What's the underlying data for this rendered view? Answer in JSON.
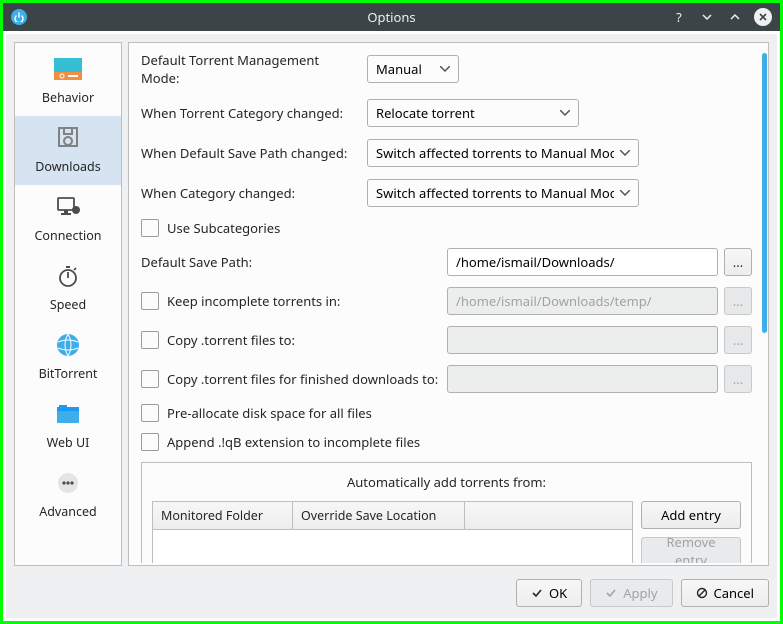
{
  "window": {
    "title": "Options"
  },
  "sidebar": {
    "items": [
      {
        "label": "Behavior"
      },
      {
        "label": "Downloads"
      },
      {
        "label": "Connection"
      },
      {
        "label": "Speed"
      },
      {
        "label": "BitTorrent"
      },
      {
        "label": "Web UI"
      },
      {
        "label": "Advanced"
      }
    ]
  },
  "form": {
    "mgmt_mode_label": "Default Torrent Management Mode:",
    "mgmt_mode_value": "Manual",
    "cat_changed_label": "When Torrent Category changed:",
    "cat_changed_value": "Relocate torrent",
    "def_path_changed_label": "When Default Save Path changed:",
    "def_path_changed_value": "Switch affected torrents to Manual Mode",
    "when_cat_changed_label": "When Category changed:",
    "when_cat_changed_value": "Switch affected torrents to Manual Mode",
    "use_subcategories": "Use Subcategories",
    "default_save_path_label": "Default Save Path:",
    "default_save_path_value": "/home/ismail/Downloads/",
    "keep_incomplete_label": "Keep incomplete torrents in:",
    "keep_incomplete_placeholder": "/home/ismail/Downloads/temp/",
    "copy_torrent_label": "Copy .torrent files to:",
    "copy_finished_label": "Copy .torrent files for finished downloads to:",
    "preallocate_label": "Pre-allocate disk space for all files",
    "append_qb_label": "Append .!qB extension to incomplete files",
    "browse_label": "..."
  },
  "autogroup": {
    "title": "Automatically add torrents from:",
    "col_monitored": "Monitored Folder",
    "col_override": "Override Save Location",
    "add_entry": "Add entry",
    "remove_entry": "Remove entry"
  },
  "footer": {
    "ok": "OK",
    "apply": "Apply",
    "cancel": "Cancel"
  }
}
